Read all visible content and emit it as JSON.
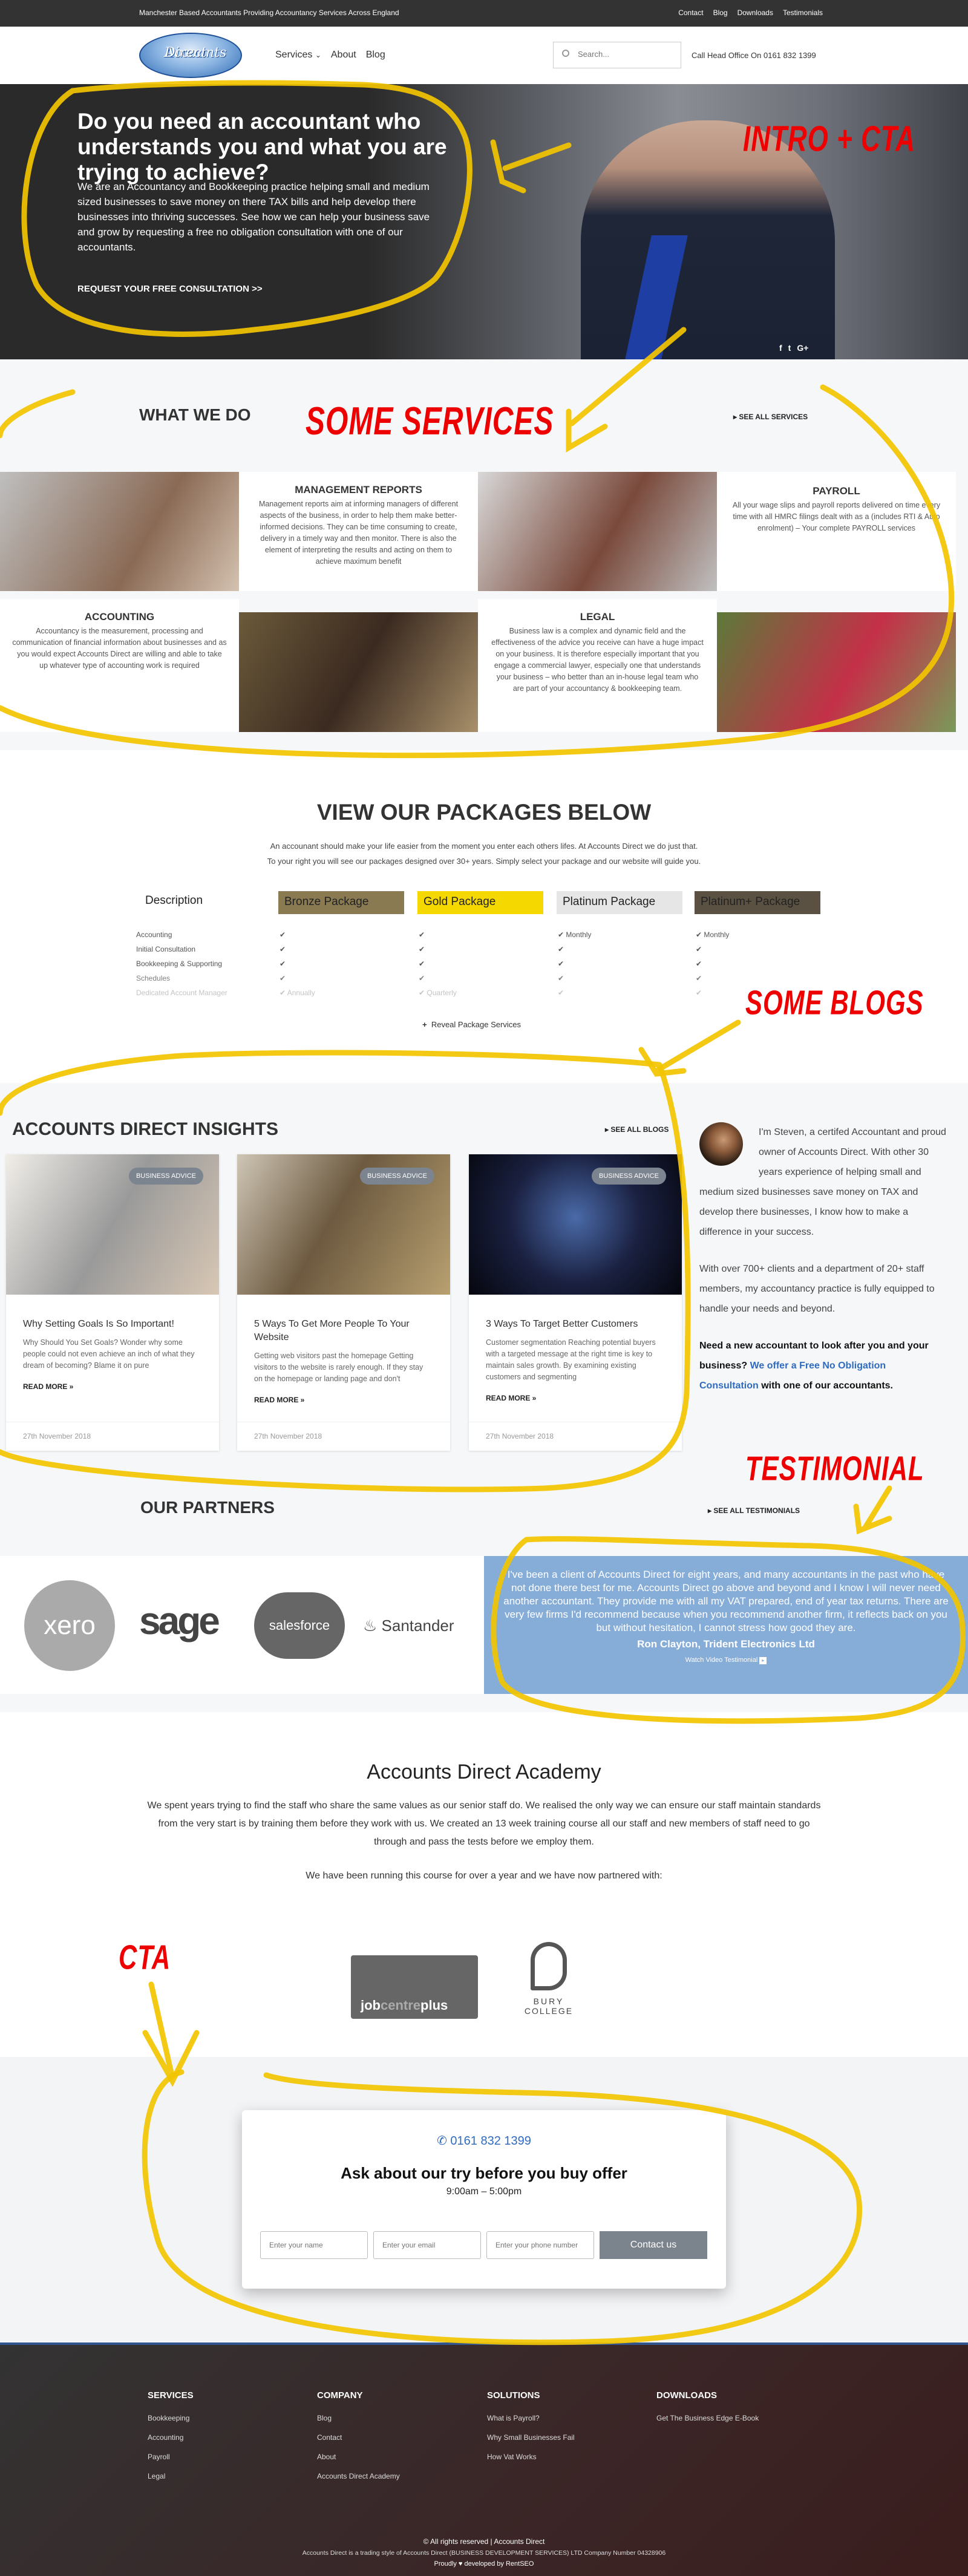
{
  "topbar": {
    "tagline": "Manchester Based Accountants Providing Accountancy Services Across England",
    "links": [
      "Contact",
      "Blog",
      "Downloads",
      "Testimonials"
    ]
  },
  "header": {
    "logo_text_1": "Accounts",
    "logo_text_2": "Direct",
    "nav": [
      "Services",
      "About",
      "Blog"
    ],
    "services_chevron": "⌄",
    "search_placeholder": "Search...",
    "call_text": "Call Head Office On 0161 832 1399"
  },
  "hero": {
    "title": "Do you need an accountant who understands you and what you are trying to achieve?",
    "body": "We are an Accountancy and Bookkeeping practice helping small and medium sized businesses to save money on there TAX bills and help develop there businesses into thriving successes. See how we can help your business save and grow by requesting a free no obligation consultation with one of our accountants.",
    "cta": "REQUEST YOUR FREE CONSULTATION >>",
    "social": [
      "f",
      "t",
      "G+"
    ]
  },
  "annotations": {
    "intro": "INTRO + CTA",
    "services": "SOME SERVICES",
    "blogs": "SOME BLOGS",
    "testimonial": "TESTIMONIAL",
    "cta": "CTA"
  },
  "services": {
    "title": "WHAT WE DO",
    "see_all": "SEE ALL SERVICES",
    "items": [
      {
        "title": "MANAGEMENT REPORTS",
        "text": "Management reports aim at informing managers of different aspects of the business, in order to help them make better-informed decisions. They can be time consuming to create, delivery in a timely way and then monitor. There is also the element of interpreting the results and acting on them to achieve maximum benefit"
      },
      {
        "title": "PAYROLL",
        "text": "All your wage slips and payroll reports delivered on time every time with all HMRC filings dealt with as a (includes RTI & Auto enrolment) – Your complete PAYROLL services"
      },
      {
        "title": "ACCOUNTING",
        "text": "Accountancy is the measurement, processing and communication of financial information about businesses and as you would expect Accounts Direct are willing and able to take up whatever type of accounting work is required"
      },
      {
        "title": "LEGAL",
        "text": "Business law is a complex and dynamic field and the effectiveness of the advice you receive can have a huge impact on your business. It is therefore especially important that you engage a commercial lawyer, especially one that understands your business – who better than an in-house legal team who are part of your accountancy & bookkeeping team."
      }
    ]
  },
  "packages": {
    "title": "VIEW OUR PACKAGES BELOW",
    "subtitle_1": "An accounant should make your life easier from the moment you enter each others lifes. At Accounts Direct we do just that.",
    "subtitle_2": "To your right you will see our packages designed over 30+ years. Simply select your package and our website will guide you.",
    "description_label": "Description",
    "columns": [
      {
        "name": "Bronze Package",
        "color": "#8a7a52"
      },
      {
        "name": "Gold Package",
        "color": "#f5d800"
      },
      {
        "name": "Platinum Package",
        "color": "#e6e6e6"
      },
      {
        "name": "Platinum+ Package",
        "color": "#5a5142"
      }
    ],
    "rows": [
      {
        "label": "Accounting",
        "values": [
          "✔",
          "✔",
          "✔ Monthly",
          "✔ Monthly"
        ]
      },
      {
        "label": "Initial Consultation",
        "values": [
          "✔",
          "✔",
          "✔",
          "✔"
        ]
      },
      {
        "label": "Bookkeeping & Supporting",
        "values": [
          "✔",
          "✔",
          "✔",
          "✔"
        ]
      },
      {
        "label": "Schedules",
        "values": [
          "✔",
          "✔",
          "✔",
          "✔"
        ]
      },
      {
        "label": "Dedicated Account Manager",
        "values": [
          "✔ Annually",
          "✔ Quarterly",
          "✔",
          "✔"
        ]
      }
    ],
    "reveal": "Reveal Package Services"
  },
  "blog": {
    "title": "ACCOUNTS DIRECT INSIGHTS",
    "see_all": "SEE ALL BLOGS",
    "posts": [
      {
        "badge": "BUSINESS ADVICE",
        "title": "Why Setting Goals Is So Important!",
        "excerpt": "Why Should You Set Goals? Wonder why some people could not even achieve an inch of what they dream of becoming? Blame it on pure",
        "read_more": "READ MORE »",
        "date": "27th November 2018"
      },
      {
        "badge": "BUSINESS ADVICE",
        "title": "5 Ways To Get More People To Your Website",
        "excerpt": "Getting web visitors past the homepage Getting visitors to the website is rarely enough. If they stay on the homepage or landing page and don't",
        "read_more": "READ MORE »",
        "date": "27th November 2018"
      },
      {
        "badge": "BUSINESS ADVICE",
        "title": "3 Ways To Target Better Customers",
        "excerpt": "Customer segmentation Reaching potential buyers with a targeted message at the right time is key to maintain sales growth. By examining existing customers and segmenting",
        "read_more": "READ MORE »",
        "date": "27th November 2018"
      }
    ]
  },
  "bio": {
    "p1": "I'm Steven, a certifed Accountant and proud owner of Accounts Direct. With other 30 years experience of helping small and medium sized businesses save money on TAX and develop there businesses, I know how to make a difference in your success.",
    "p2": "With over 700+ clients and a department of 20+ staff members, my accountancy practice is fully equipped to handle your needs and beyond.",
    "p3_start": "Need a new accountant to look after you and your business? ",
    "p3_link": "We offer a Free No Obligation Consultation",
    "p3_end": " with one of our accountants."
  },
  "partners": {
    "title": "OUR PARTNERS",
    "see_all": "SEE ALL TESTIMONIALS",
    "logos": [
      "xero",
      "sage",
      "salesforce",
      "Santander"
    ]
  },
  "testimonial": {
    "quote": "I've been a client of Accounts Direct for eight years, and many accountants in the past who have not done there best for me. Accounts Direct go above and beyond and I know I will never need another accountant. They provide me with all my VAT prepared, end of year tax returns. There are very few firms I'd recommend because when you recommend another firm, it reflects back on you but without hesitation, I cannot stress how good they are.",
    "author": "Ron Clayton, Trident Electronics Ltd",
    "video": "Watch Video Testimonial"
  },
  "academy": {
    "title": "Accounts Direct Academy",
    "body": "We spent years trying to find the staff who share the same values as our senior staff do. We realised the only way we can ensure our staff maintain standards from the very start is by training them before they work with us. We created an 13 week training course all our staff and new members of staff need to go through and pass the tests before we employ them.",
    "body2": "We have been running this course for over a year and we have now partnered with:",
    "jobcentre_1": "job",
    "jobcentre_2": "centre",
    "jobcentre_3": "plus",
    "bury_1": "BURY",
    "bury_2": "COLLEGE"
  },
  "cta": {
    "phone": "0161 832 1399",
    "title": "Ask about our try before you buy offer",
    "hours": "9:00am – 5:00pm",
    "name_placeholder": "Enter your name",
    "email_placeholder": "Enter your email",
    "phone_placeholder": "Enter your phone number",
    "submit": "Contact us"
  },
  "footer": {
    "columns": [
      {
        "title": "SERVICES",
        "links": [
          "Bookkeeping",
          "Accounting",
          "Payroll",
          "Legal"
        ]
      },
      {
        "title": "COMPANY",
        "links": [
          "Blog",
          "Contact",
          "About",
          "Accounts Direct Academy"
        ]
      },
      {
        "title": "SOLUTIONS",
        "links": [
          "What is Payroll?",
          "Why Small Businesses Fail",
          "How Vat Works"
        ]
      },
      {
        "title": "DOWNLOADS",
        "links": [
          "Get The Business Edge E-Book"
        ]
      }
    ],
    "copyright": "© All rights reserved | Accounts Direct",
    "legal": "Accounts Direct is a trading style of Accounts Direct (BUSINESS DEVELOPMENT SERVICES) LTD Company Number 04328906",
    "credit": "Proudly ♥ developed by RentSEO"
  }
}
